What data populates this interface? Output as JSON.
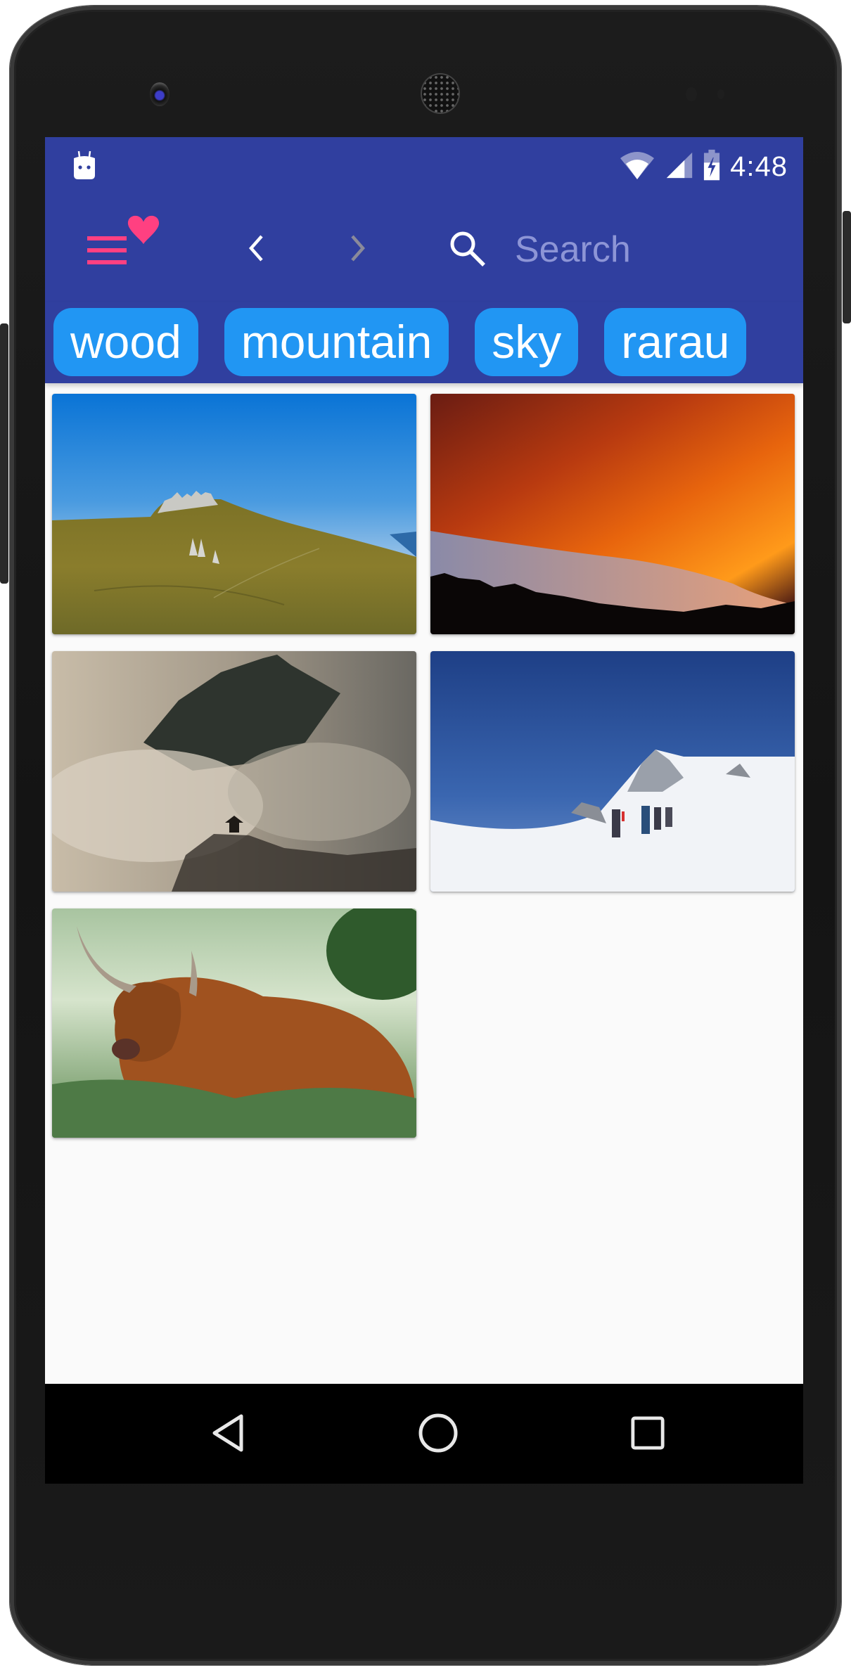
{
  "status_bar": {
    "time": "4:48",
    "icons": [
      "android-debug-icon",
      "wifi-icon",
      "cell-signal-icon",
      "battery-charging-icon"
    ]
  },
  "toolbar": {
    "menu_icon": "menu-icon",
    "favorite_icon": "heart-icon",
    "back_icon": "chevron-left-icon",
    "forward_icon": "chevron-right-icon",
    "search_icon": "search-icon",
    "search_placeholder": "Search",
    "search_value": "",
    "colors": {
      "primary": "#303f9f",
      "accent": "#ff4081",
      "chip": "#2196f3"
    }
  },
  "tags": [
    {
      "label": "wood"
    },
    {
      "label": "mountain"
    },
    {
      "label": "sky"
    },
    {
      "label": "rarau"
    }
  ],
  "images": [
    {
      "description": "Grassy mountain with rocky peaks under a blue sky"
    },
    {
      "description": "Fiery orange sunset clouds over a dark mountain ridge"
    },
    {
      "description": "Misty mountain peak with fog and a pagoda"
    },
    {
      "description": "Climbers ascending a snowy ridge under blue sky"
    },
    {
      "description": "Highland cow lying in green grass"
    }
  ],
  "nav_bar": {
    "back": "nav-back-icon",
    "home": "nav-home-icon",
    "recents": "nav-recents-icon"
  }
}
